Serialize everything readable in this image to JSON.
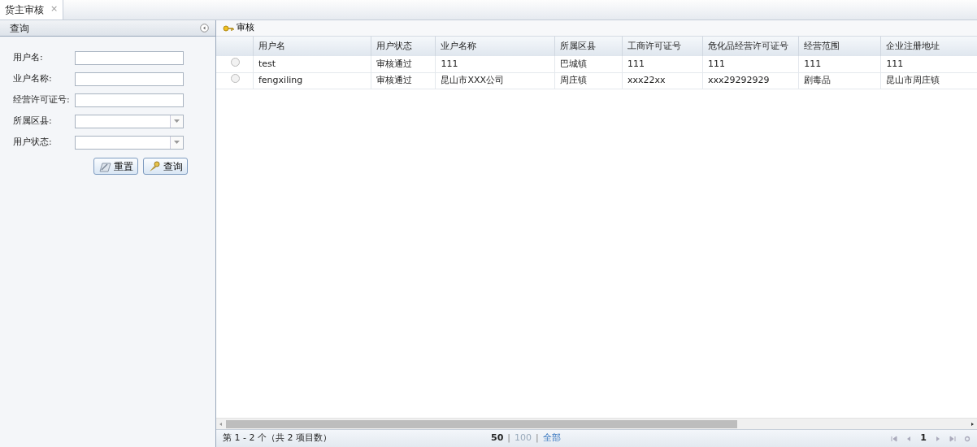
{
  "tabs": [
    {
      "label": "货主审核",
      "selected": true,
      "close": "×"
    }
  ],
  "query_panel": {
    "title": "查询",
    "fields": [
      {
        "label": "用户名:",
        "kind": "text"
      },
      {
        "label": "业户名称:",
        "kind": "text"
      },
      {
        "label": "经营许可证号:",
        "kind": "text"
      },
      {
        "label": "所属区县:",
        "kind": "select"
      },
      {
        "label": "用户状态:",
        "kind": "select"
      }
    ],
    "buttons": [
      {
        "label": "重置",
        "kind": "reset"
      },
      {
        "label": "查询",
        "kind": "search"
      }
    ]
  },
  "grid": {
    "toolbar": [
      {
        "label": "审核"
      }
    ],
    "columns": [
      "用户名",
      "用户状态",
      "业户名称",
      "所属区县",
      "工商许可证号",
      "危化品经营许可证号",
      "经营范围",
      "企业注册地址"
    ],
    "rows": [
      {
        "selected": false,
        "cells": [
          "test",
          "审核通过",
          "111",
          "巴城镇",
          "111",
          "111",
          "111",
          "111"
        ]
      },
      {
        "selected": false,
        "cells": [
          "fengxiling",
          "审核通过",
          "昆山市XXX公司",
          "周庄镇",
          "xxx22xx",
          "xxx29292929",
          "剧毒品",
          "昆山市周庄镇"
        ]
      }
    ],
    "scroll": {
      "level": 0.69
    },
    "summary": "第 1 - 2 个（共 2 项目数）",
    "page_sizes": [
      {
        "label": "50",
        "selected": true
      },
      {
        "label": "100",
        "selected": false
      },
      {
        "label": "全部",
        "selected": false
      }
    ],
    "page_size_separator": "|",
    "page": "1"
  }
}
